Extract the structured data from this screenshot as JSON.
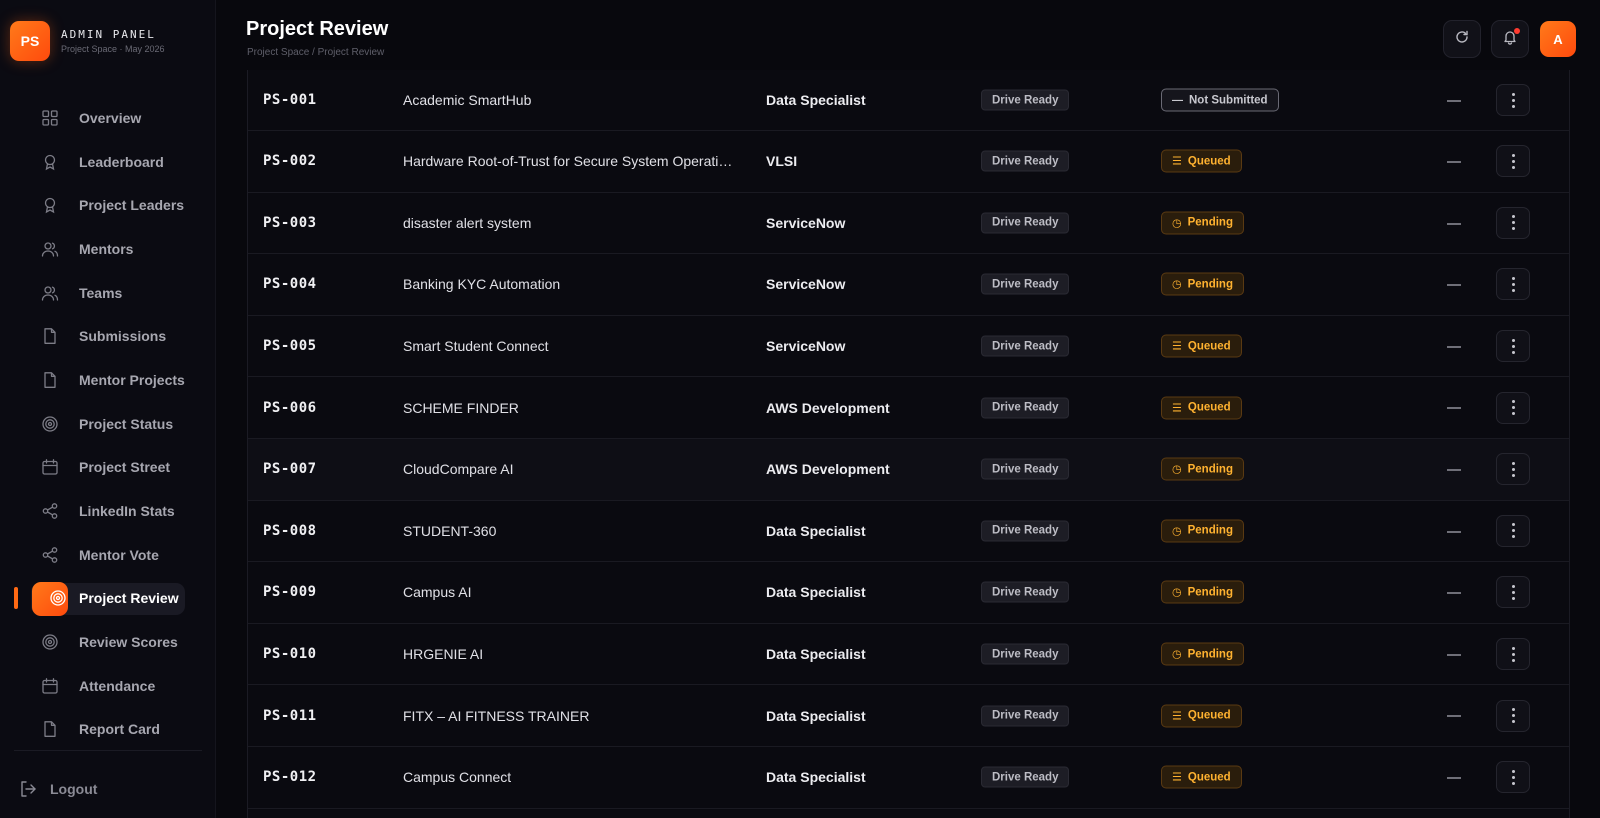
{
  "brand": {
    "logo": "PS",
    "title": "ADMIN PANEL",
    "subtitle": "Project Space · May 2026"
  },
  "nav": [
    {
      "label": "Overview",
      "icon": "grid-icon"
    },
    {
      "label": "Leaderboard",
      "icon": "award-icon"
    },
    {
      "label": "Project Leaders",
      "icon": "award-icon"
    },
    {
      "label": "Mentors",
      "icon": "users-icon"
    },
    {
      "label": "Teams",
      "icon": "users-icon"
    },
    {
      "label": "Submissions",
      "icon": "file-icon"
    },
    {
      "label": "Mentor Projects",
      "icon": "file-icon"
    },
    {
      "label": "Project Status",
      "icon": "target-icon"
    },
    {
      "label": "Project Street",
      "icon": "calendar-icon"
    },
    {
      "label": "LinkedIn Stats",
      "icon": "share-icon"
    },
    {
      "label": "Mentor Vote",
      "icon": "share-icon"
    },
    {
      "label": "Project Review",
      "icon": "target-icon",
      "active": true
    },
    {
      "label": "Review Scores",
      "icon": "target-icon"
    },
    {
      "label": "Attendance",
      "icon": "calendar-icon"
    },
    {
      "label": "Report Card",
      "icon": "file-icon"
    }
  ],
  "logout": "Logout",
  "header": {
    "title": "Project Review",
    "breadcrumb": "Project Space / Project Review",
    "avatar": "A"
  },
  "colors": {
    "accent": "#ff6a14",
    "status_warn": "#ffb230",
    "bg": "#08080d"
  },
  "rows": [
    {
      "id": "PS-001",
      "name": "Academic SmartHub",
      "domain": "Data Specialist",
      "drive": "Drive Ready",
      "status": "Not Submitted",
      "status_type": "ns"
    },
    {
      "id": "PS-002",
      "name": "Hardware Root-of-Trust for Secure System Operati…",
      "domain": "VLSI",
      "drive": "Drive Ready",
      "status": "Queued",
      "status_type": "queued"
    },
    {
      "id": "PS-003",
      "name": "disaster alert system",
      "domain": "ServiceNow",
      "drive": "Drive Ready",
      "status": "Pending",
      "status_type": "pending"
    },
    {
      "id": "PS-004",
      "name": "Banking KYC Automation",
      "domain": "ServiceNow",
      "drive": "Drive Ready",
      "status": "Pending",
      "status_type": "pending"
    },
    {
      "id": "PS-005",
      "name": "Smart Student Connect",
      "domain": "ServiceNow",
      "drive": "Drive Ready",
      "status": "Queued",
      "status_type": "queued"
    },
    {
      "id": "PS-006",
      "name": "SCHEME FINDER",
      "domain": "AWS Development",
      "drive": "Drive Ready",
      "status": "Queued",
      "status_type": "queued"
    },
    {
      "id": "PS-007",
      "name": "CloudCompare AI",
      "domain": "AWS Development",
      "drive": "Drive Ready",
      "status": "Pending",
      "status_type": "pending"
    },
    {
      "id": "PS-008",
      "name": "STUDENT-360",
      "domain": "Data Specialist",
      "drive": "Drive Ready",
      "status": "Pending",
      "status_type": "pending"
    },
    {
      "id": "PS-009",
      "name": "Campus AI",
      "domain": "Data Specialist",
      "drive": "Drive Ready",
      "status": "Pending",
      "status_type": "pending"
    },
    {
      "id": "PS-010",
      "name": "HRGENIE AI",
      "domain": "Data Specialist",
      "drive": "Drive Ready",
      "status": "Pending",
      "status_type": "pending"
    },
    {
      "id": "PS-011",
      "name": "FITX – AI FITNESS TRAINER",
      "domain": "Data Specialist",
      "drive": "Drive Ready",
      "status": "Queued",
      "status_type": "queued"
    },
    {
      "id": "PS-012",
      "name": "Campus Connect",
      "domain": "Data Specialist",
      "drive": "Drive Ready",
      "status": "Queued",
      "status_type": "queued"
    }
  ]
}
